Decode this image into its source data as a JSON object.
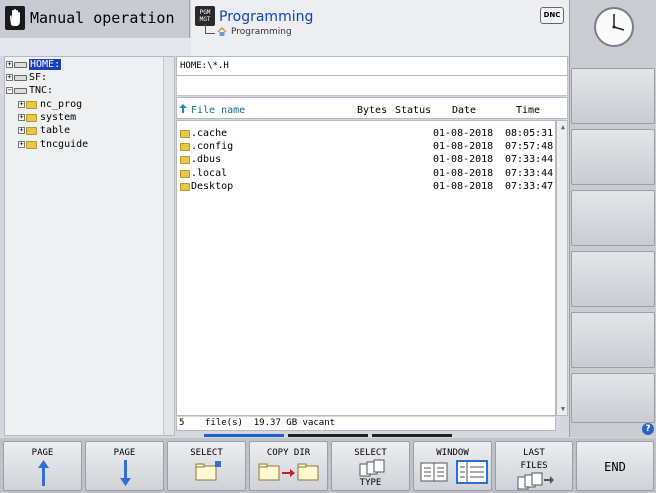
{
  "header": {
    "mode_title": "Manual operation",
    "program_title": "Programming",
    "program_subtitle": "Programming",
    "pgm_icon_line1": "PGM",
    "pgm_icon_line2": "MGT",
    "dnc_label": "DNC"
  },
  "tree": {
    "items": [
      {
        "label": "HOME:",
        "selected": true
      },
      {
        "label": "SF:"
      },
      {
        "label": "TNC:"
      },
      {
        "label": "nc_prog"
      },
      {
        "label": "system"
      },
      {
        "label": "table"
      },
      {
        "label": "tncguide"
      }
    ]
  },
  "files": {
    "path": "HOME:\\*.H",
    "columns": {
      "name": "File name",
      "bytes": "Bytes",
      "status": "Status",
      "date": "Date",
      "time": "Time"
    },
    "rows": [
      {
        "name": ".cache",
        "date": "01-08-2018",
        "time": "08:05:31"
      },
      {
        "name": ".config",
        "date": "01-08-2018",
        "time": "07:57:48"
      },
      {
        "name": ".dbus",
        "date": "01-08-2018",
        "time": "07:33:44"
      },
      {
        "name": ".local",
        "date": "01-08-2018",
        "time": "07:33:44"
      },
      {
        "name": "Desktop",
        "date": "01-08-2018",
        "time": "07:33:47"
      }
    ],
    "status_count": "5",
    "status_text": "file(s)  19.37 GB vacant"
  },
  "softkeys": {
    "page_up": "PAGE",
    "page_down": "PAGE",
    "select": "SELECT",
    "copy_dir": "COPY DIR",
    "select_type_1": "SELECT",
    "select_type_2": "TYPE",
    "window": "WINDOW",
    "last_files_1": "LAST",
    "last_files_2": "FILES",
    "end": "END"
  },
  "help_icon": "?"
}
